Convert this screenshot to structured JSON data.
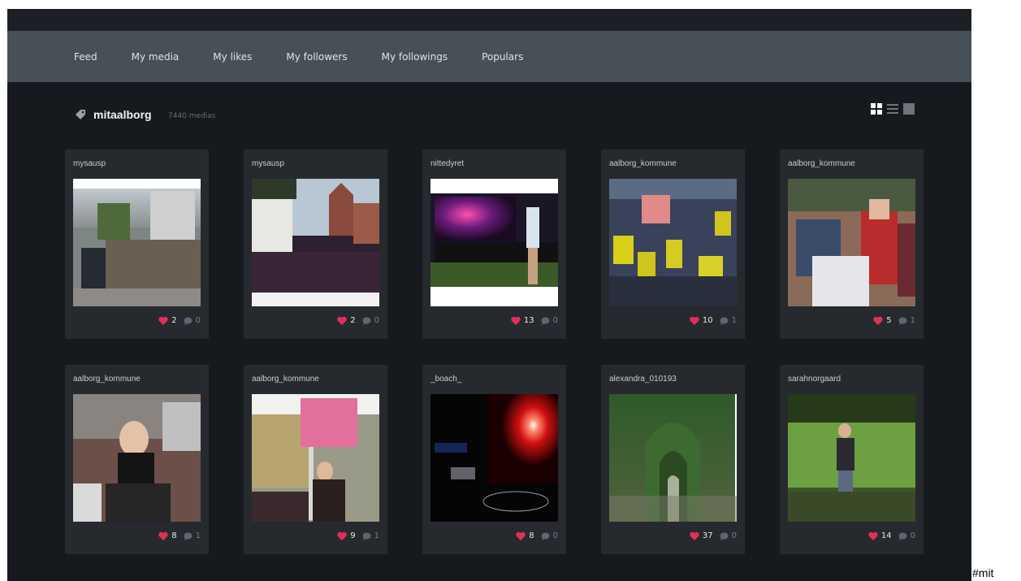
{
  "nav": {
    "items": [
      {
        "label": "Feed"
      },
      {
        "label": "My media"
      },
      {
        "label": "My likes"
      },
      {
        "label": "My followers"
      },
      {
        "label": "My followings"
      },
      {
        "label": "Populars"
      }
    ]
  },
  "tag": {
    "icon": "tag-icon",
    "name": "mitaalborg",
    "count": "7440 medias"
  },
  "view_toggles": [
    {
      "icon": "grid-view-icon"
    },
    {
      "icon": "list-view-icon"
    },
    {
      "icon": "single-view-icon"
    }
  ],
  "colors": {
    "accent_heart": "#e0305a",
    "background": "#16191d",
    "nav_bar": "#474f57",
    "card": "#262a2f"
  },
  "cards": [
    {
      "user": "mysausp",
      "likes": "2",
      "comments": "0",
      "photo": "campus-lecture-hall"
    },
    {
      "user": "mysausp",
      "likes": "2",
      "comments": "0",
      "photo": "crowd-church"
    },
    {
      "user": "nittedyret",
      "likes": "13",
      "comments": "0",
      "photo": "concert-stage"
    },
    {
      "user": "aalborg_kommune",
      "likes": "10",
      "comments": "1",
      "photo": "crowd-yellow-shirts"
    },
    {
      "user": "aalborg_kommune",
      "likes": "5",
      "comments": "1",
      "photo": "students-party"
    },
    {
      "user": "aalborg_kommune",
      "likes": "8",
      "comments": "1",
      "photo": "woman-black-scarf"
    },
    {
      "user": "aalborg_kommune",
      "likes": "9",
      "comments": "1",
      "photo": "protest-sign"
    },
    {
      "user": "_boach_",
      "likes": "8",
      "comments": "0",
      "photo": "dark-red-light"
    },
    {
      "user": "alexandra_010193",
      "likes": "37",
      "comments": "0",
      "photo": "green-archway"
    },
    {
      "user": "sarahnorgaard",
      "likes": "14",
      "comments": "0",
      "photo": "swing-park"
    }
  ],
  "caption": "#mit"
}
